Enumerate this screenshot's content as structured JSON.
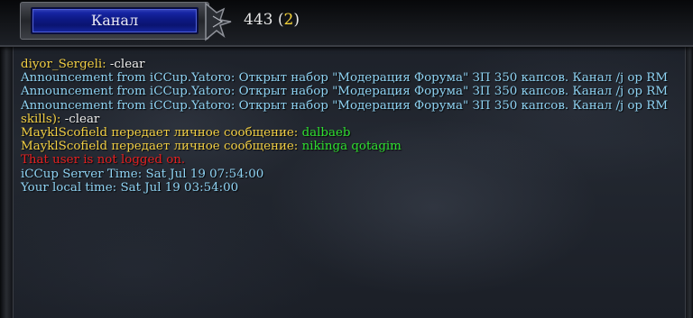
{
  "header": {
    "channel_button_label": "Канал",
    "user_count": "443",
    "friends_count": "2"
  },
  "colors": {
    "username": "#f2cf44",
    "message": "#efefef",
    "announcement": "#8fd3f3",
    "whisper_text": "#2fe02f",
    "error": "#e42020",
    "channel_button": "#0d1883"
  },
  "messages": [
    {
      "type": "chat",
      "user": "diyor_Sergeli:",
      "text": " -clear"
    },
    {
      "type": "announcement",
      "text": "Announcement from iCCup.Yatoro: Открыт набор \"Модерация Форума\" ЗП 350 капсов. Канал /j op RM"
    },
    {
      "type": "announcement",
      "text": "Announcement from iCCup.Yatoro: Открыт набор \"Модерация Форума\" ЗП 350 капсов. Канал /j op RM"
    },
    {
      "type": "announcement",
      "text": "Announcement from iCCup.Yatoro: Открыт набор \"Модерация Форума\" ЗП 350 капсов. Канал /j op RM"
    },
    {
      "type": "chat",
      "user": "skills):",
      "text": " -clear"
    },
    {
      "type": "whisper",
      "prefix": "MayklScofield передает личное сообщение: ",
      "text": "dalbaeb"
    },
    {
      "type": "whisper",
      "prefix": "MayklScofield передает личное сообщение: ",
      "text": "nikinga qotagim"
    },
    {
      "type": "error",
      "text": "That user is not logged on."
    },
    {
      "type": "info",
      "text": "iCCup Server Time: Sat Jul 19 07:54:00"
    },
    {
      "type": "info",
      "text": "Your local time: Sat Jul 19 03:54:00"
    }
  ]
}
